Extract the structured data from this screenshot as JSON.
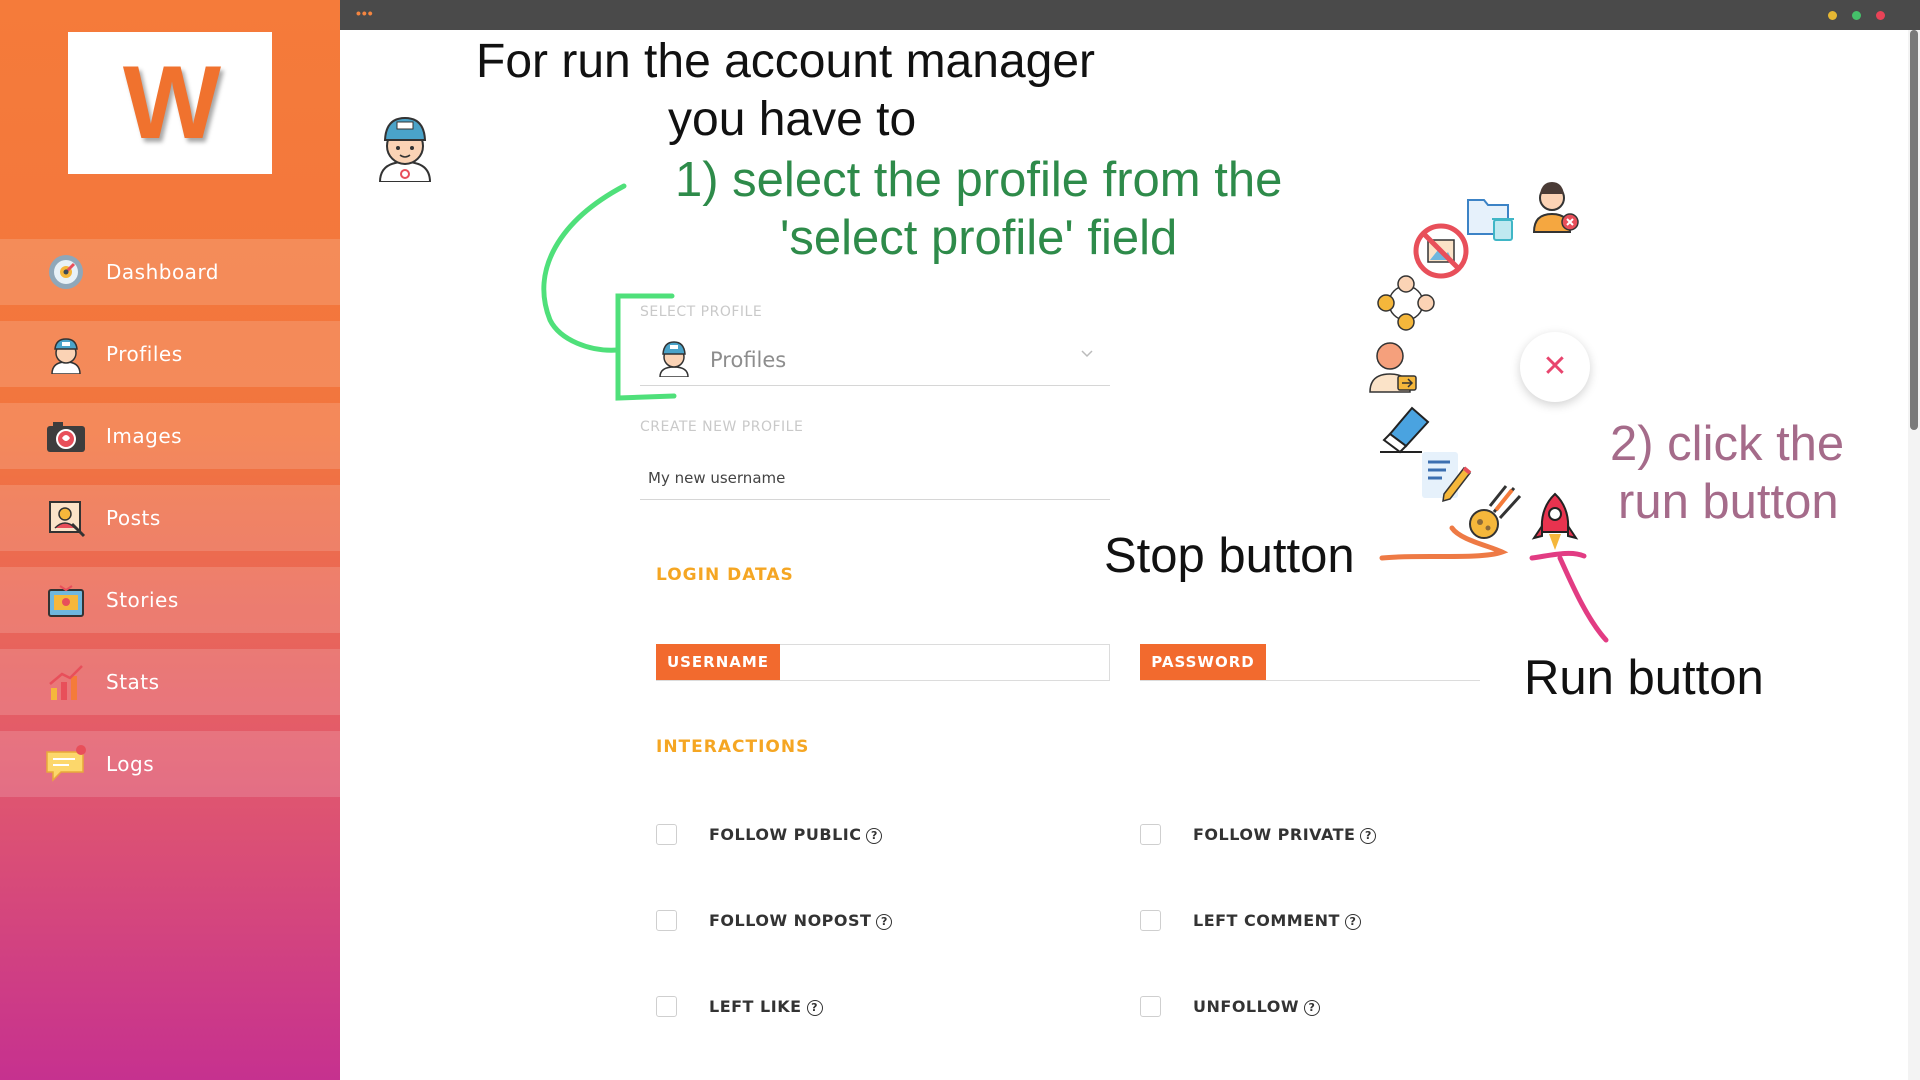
{
  "app": {
    "logo_letter": "W",
    "accent": "#f26a2e"
  },
  "sidebar": {
    "items": [
      {
        "label": "Dashboard",
        "icon": "dashboard-icon"
      },
      {
        "label": "Profiles",
        "icon": "profile-avatar-icon"
      },
      {
        "label": "Images",
        "icon": "camera-icon"
      },
      {
        "label": "Posts",
        "icon": "posts-icon"
      },
      {
        "label": "Stories",
        "icon": "stories-icon"
      },
      {
        "label": "Stats",
        "icon": "stats-chart-icon"
      },
      {
        "label": "Logs",
        "icon": "logs-chat-icon"
      }
    ]
  },
  "annotations": {
    "intro_line1": "For run the account manager",
    "intro_line2": "you have to",
    "step1_line1": "1) select the profile from the",
    "step1_line2": "'select profile' field",
    "step2_line1": "2) click the",
    "step2_line2": "run button",
    "stop_button": "Stop button",
    "run_button": "Run button"
  },
  "form": {
    "select_profile_label": "SELECT PROFILE",
    "select_profile_value": "Profiles",
    "create_profile_label": "CREATE NEW PROFILE",
    "create_profile_value": "My new username",
    "login_title": "LOGIN DATAS",
    "username_label": "USERNAME",
    "password_label": "PASSWORD",
    "interactions_title": "INTERACTIONS",
    "help_glyph": "?",
    "interactions": [
      {
        "label": "FOLLOW PUBLIC",
        "checked": false
      },
      {
        "label": "FOLLOW PRIVATE",
        "checked": false
      },
      {
        "label": "FOLLOW NOPOST",
        "checked": false
      },
      {
        "label": "LEFT COMMENT",
        "checked": false
      },
      {
        "label": "LEFT LIKE",
        "checked": false
      },
      {
        "label": "UNFOLLOW",
        "checked": false
      }
    ]
  },
  "actions": {
    "close_glyph": "✕"
  }
}
